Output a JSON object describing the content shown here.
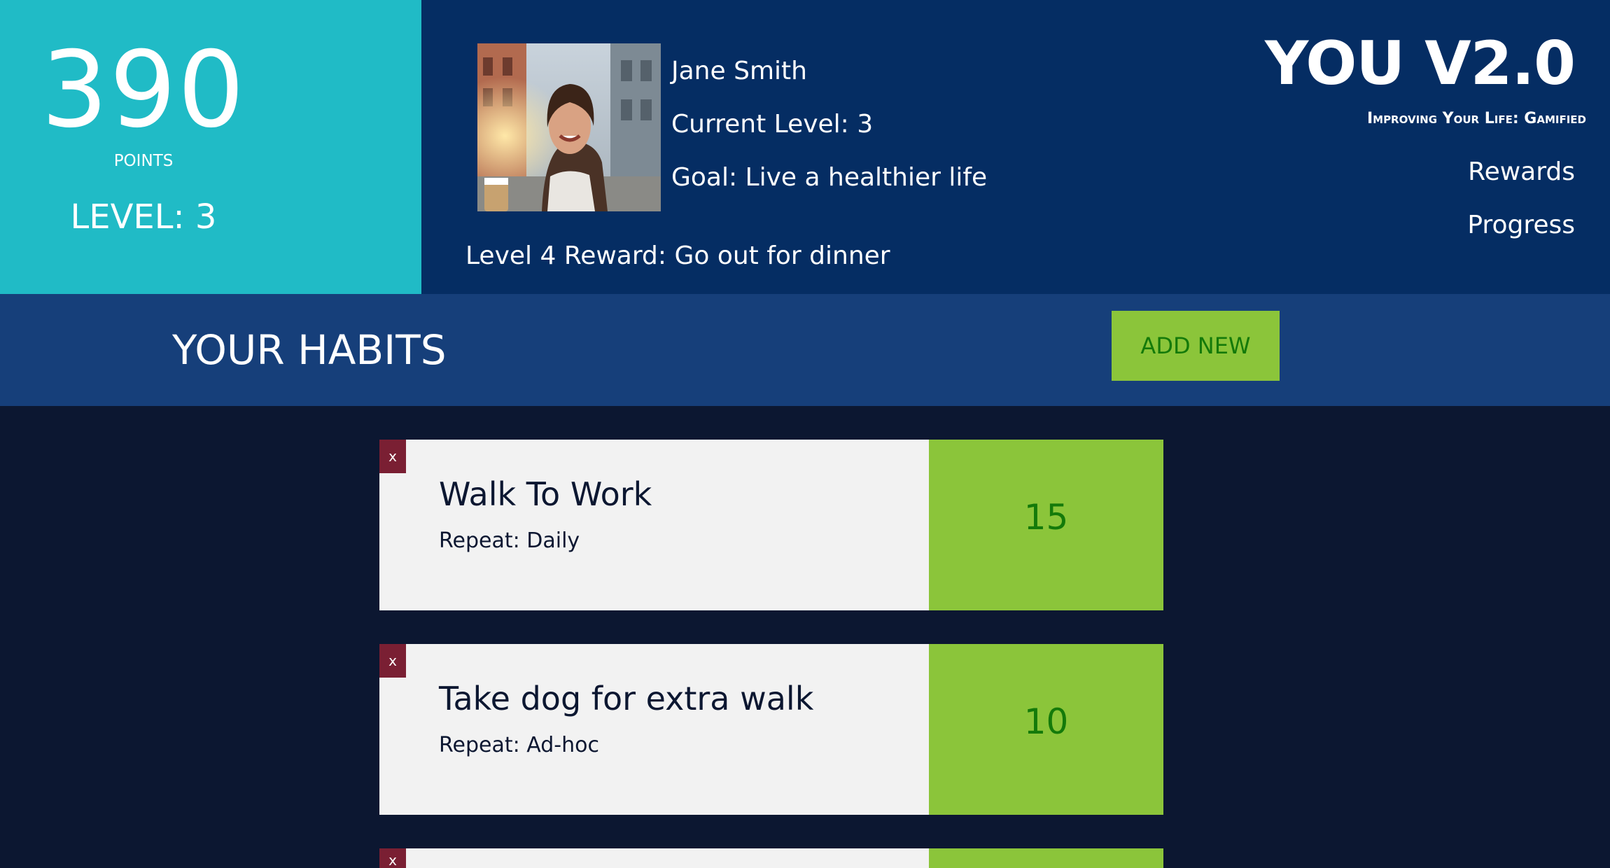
{
  "score": {
    "points": "390",
    "points_label": "POINTS",
    "level_label": "LEVEL: 3"
  },
  "profile": {
    "name": "Jane Smith",
    "current_level": "Current Level: 3",
    "goal": "Goal: Live a healthier life",
    "next_reward": "Level 4 Reward: Go out for dinner"
  },
  "brand": {
    "title": "YOU V2.0",
    "tagline": "Improving Your Life: Gamified"
  },
  "nav": {
    "rewards": "Rewards",
    "progress": "Progress"
  },
  "habits_section": {
    "title": "YOUR HABITS",
    "add_new_label": "ADD NEW"
  },
  "habits": [
    {
      "delete_label": "x",
      "name": "Walk To Work",
      "repeat": "Repeat: Daily",
      "points": "15"
    },
    {
      "delete_label": "x",
      "name": "Take dog for extra walk",
      "repeat": "Repeat: Ad-hoc",
      "points": "10"
    },
    {
      "delete_label": "x",
      "name": "",
      "repeat": "",
      "points": ""
    }
  ],
  "colors": {
    "score_panel": "#20bbc6",
    "header_bg": "#052d63",
    "habits_bar_bg": "#163f7a",
    "page_bg": "#0c1731",
    "accent_green": "#8bc53a",
    "points_text": "#147a0a",
    "delete_red": "#7a1f33",
    "card_bg": "#f2f2f2"
  }
}
